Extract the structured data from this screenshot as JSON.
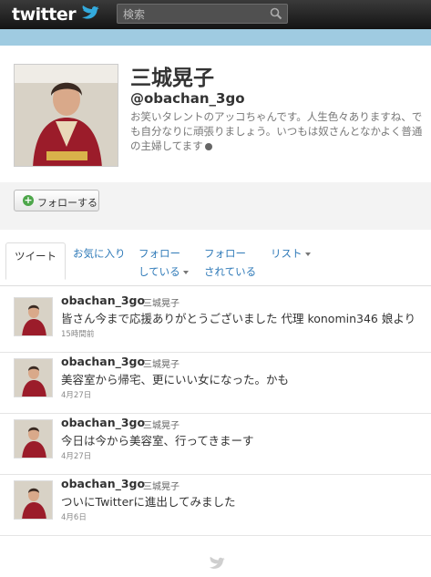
{
  "header": {
    "logo_text": "twitter",
    "search_placeholder": "検索"
  },
  "profile": {
    "name": "三城晃子",
    "handle": "@obachan_3go",
    "bio": "お笑いタレントのアッコちゃんです。人生色々ありますね、でも自分なりに頑張りましょう。いつもは奴さんとなかよく普通の主婦してます"
  },
  "actions": {
    "follow_label": "フォローする"
  },
  "tabs": [
    {
      "label": "ツイート"
    },
    {
      "label": "お気に入り"
    },
    {
      "label": "フォロー",
      "label2": "している"
    },
    {
      "label": "フォロー",
      "label2": "されている"
    },
    {
      "label": "リスト"
    }
  ],
  "tweets": [
    {
      "username": "obachan_3go",
      "fullname": "三城晃子",
      "text": "皆さん今まで応援ありがとうございました 代理 konomin346 娘より",
      "time": "15時間前"
    },
    {
      "username": "obachan_3go",
      "fullname": "三城晃子",
      "text": "美容室から帰宅、更にいい女になった。かも",
      "time": "4月27日"
    },
    {
      "username": "obachan_3go",
      "fullname": "三城晃子",
      "text": "今日は今から美容室、行ってきまーす",
      "time": "4月27日"
    },
    {
      "username": "obachan_3go",
      "fullname": "三城晃子",
      "text": "ついにTwitterに進出してみました",
      "time": "4月6日"
    }
  ],
  "colors": {
    "topbar": "#1c1c1c",
    "band": "#9fcbe1",
    "link": "#2f7ab8",
    "follow_plus": "#4da64a"
  }
}
